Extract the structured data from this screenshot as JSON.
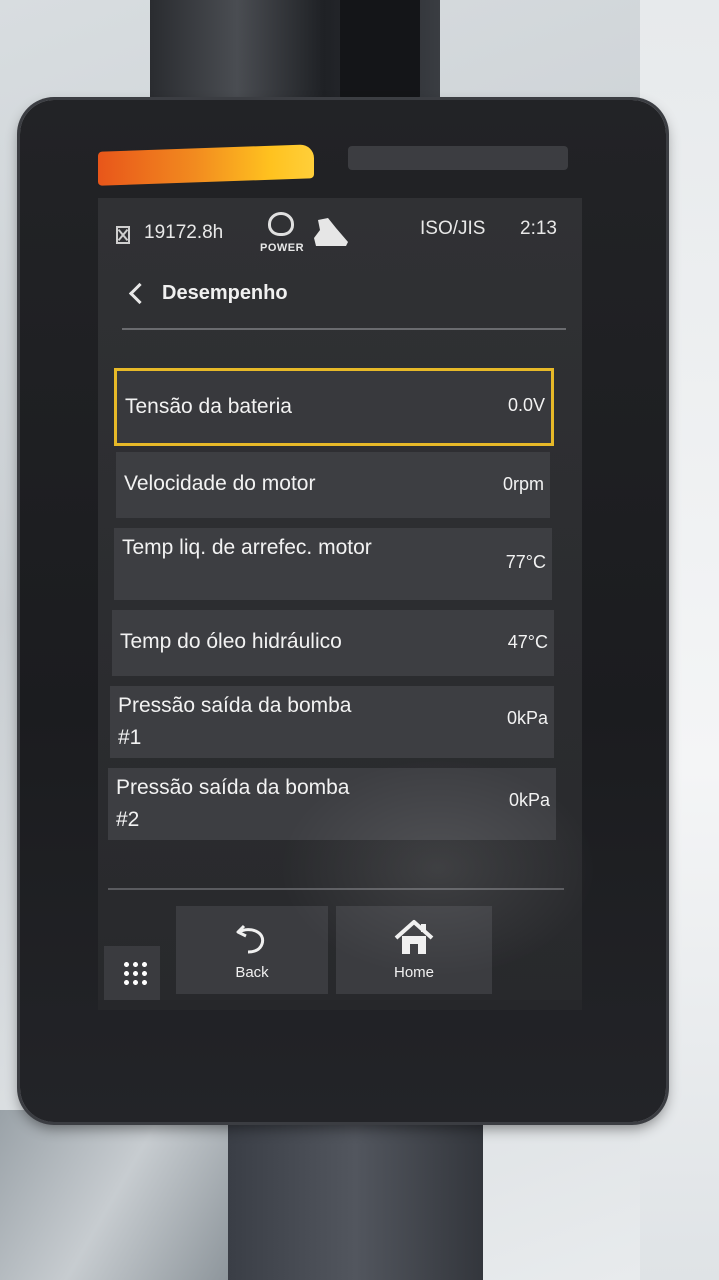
{
  "status_bar": {
    "hour_meter": "19172.8h",
    "mode_label": "POWER",
    "standard": "ISO/JIS",
    "time": "2:13"
  },
  "header": {
    "title": "Desempenho"
  },
  "rows": [
    {
      "label": "Tensão da bateria",
      "value": "0.0V",
      "selected": true
    },
    {
      "label": "Velocidade do motor",
      "value": "0rpm"
    },
    {
      "label": "Temp liq. de arrefec. motor",
      "value": "77°C"
    },
    {
      "label": "Temp do óleo hidráulico",
      "value": "47°C"
    },
    {
      "label": "Pressão saída da bomba #1",
      "value": "0kPa"
    },
    {
      "label": "Pressão saída da bomba #2",
      "value": "0kPa"
    }
  ],
  "nav": {
    "back_label": "Back",
    "home_label": "Home"
  },
  "colors": {
    "selection": "#e7b928",
    "screen_bg": "#2c2d30",
    "row_bg": "#3d3e42",
    "accent_bar": "#f28b1f"
  },
  "icons": [
    "hour-meter-icon",
    "power-mode-icon",
    "bucket-icon",
    "back-chevron-icon",
    "menu-grid-icon",
    "undo-arrow-icon",
    "home-icon"
  ]
}
